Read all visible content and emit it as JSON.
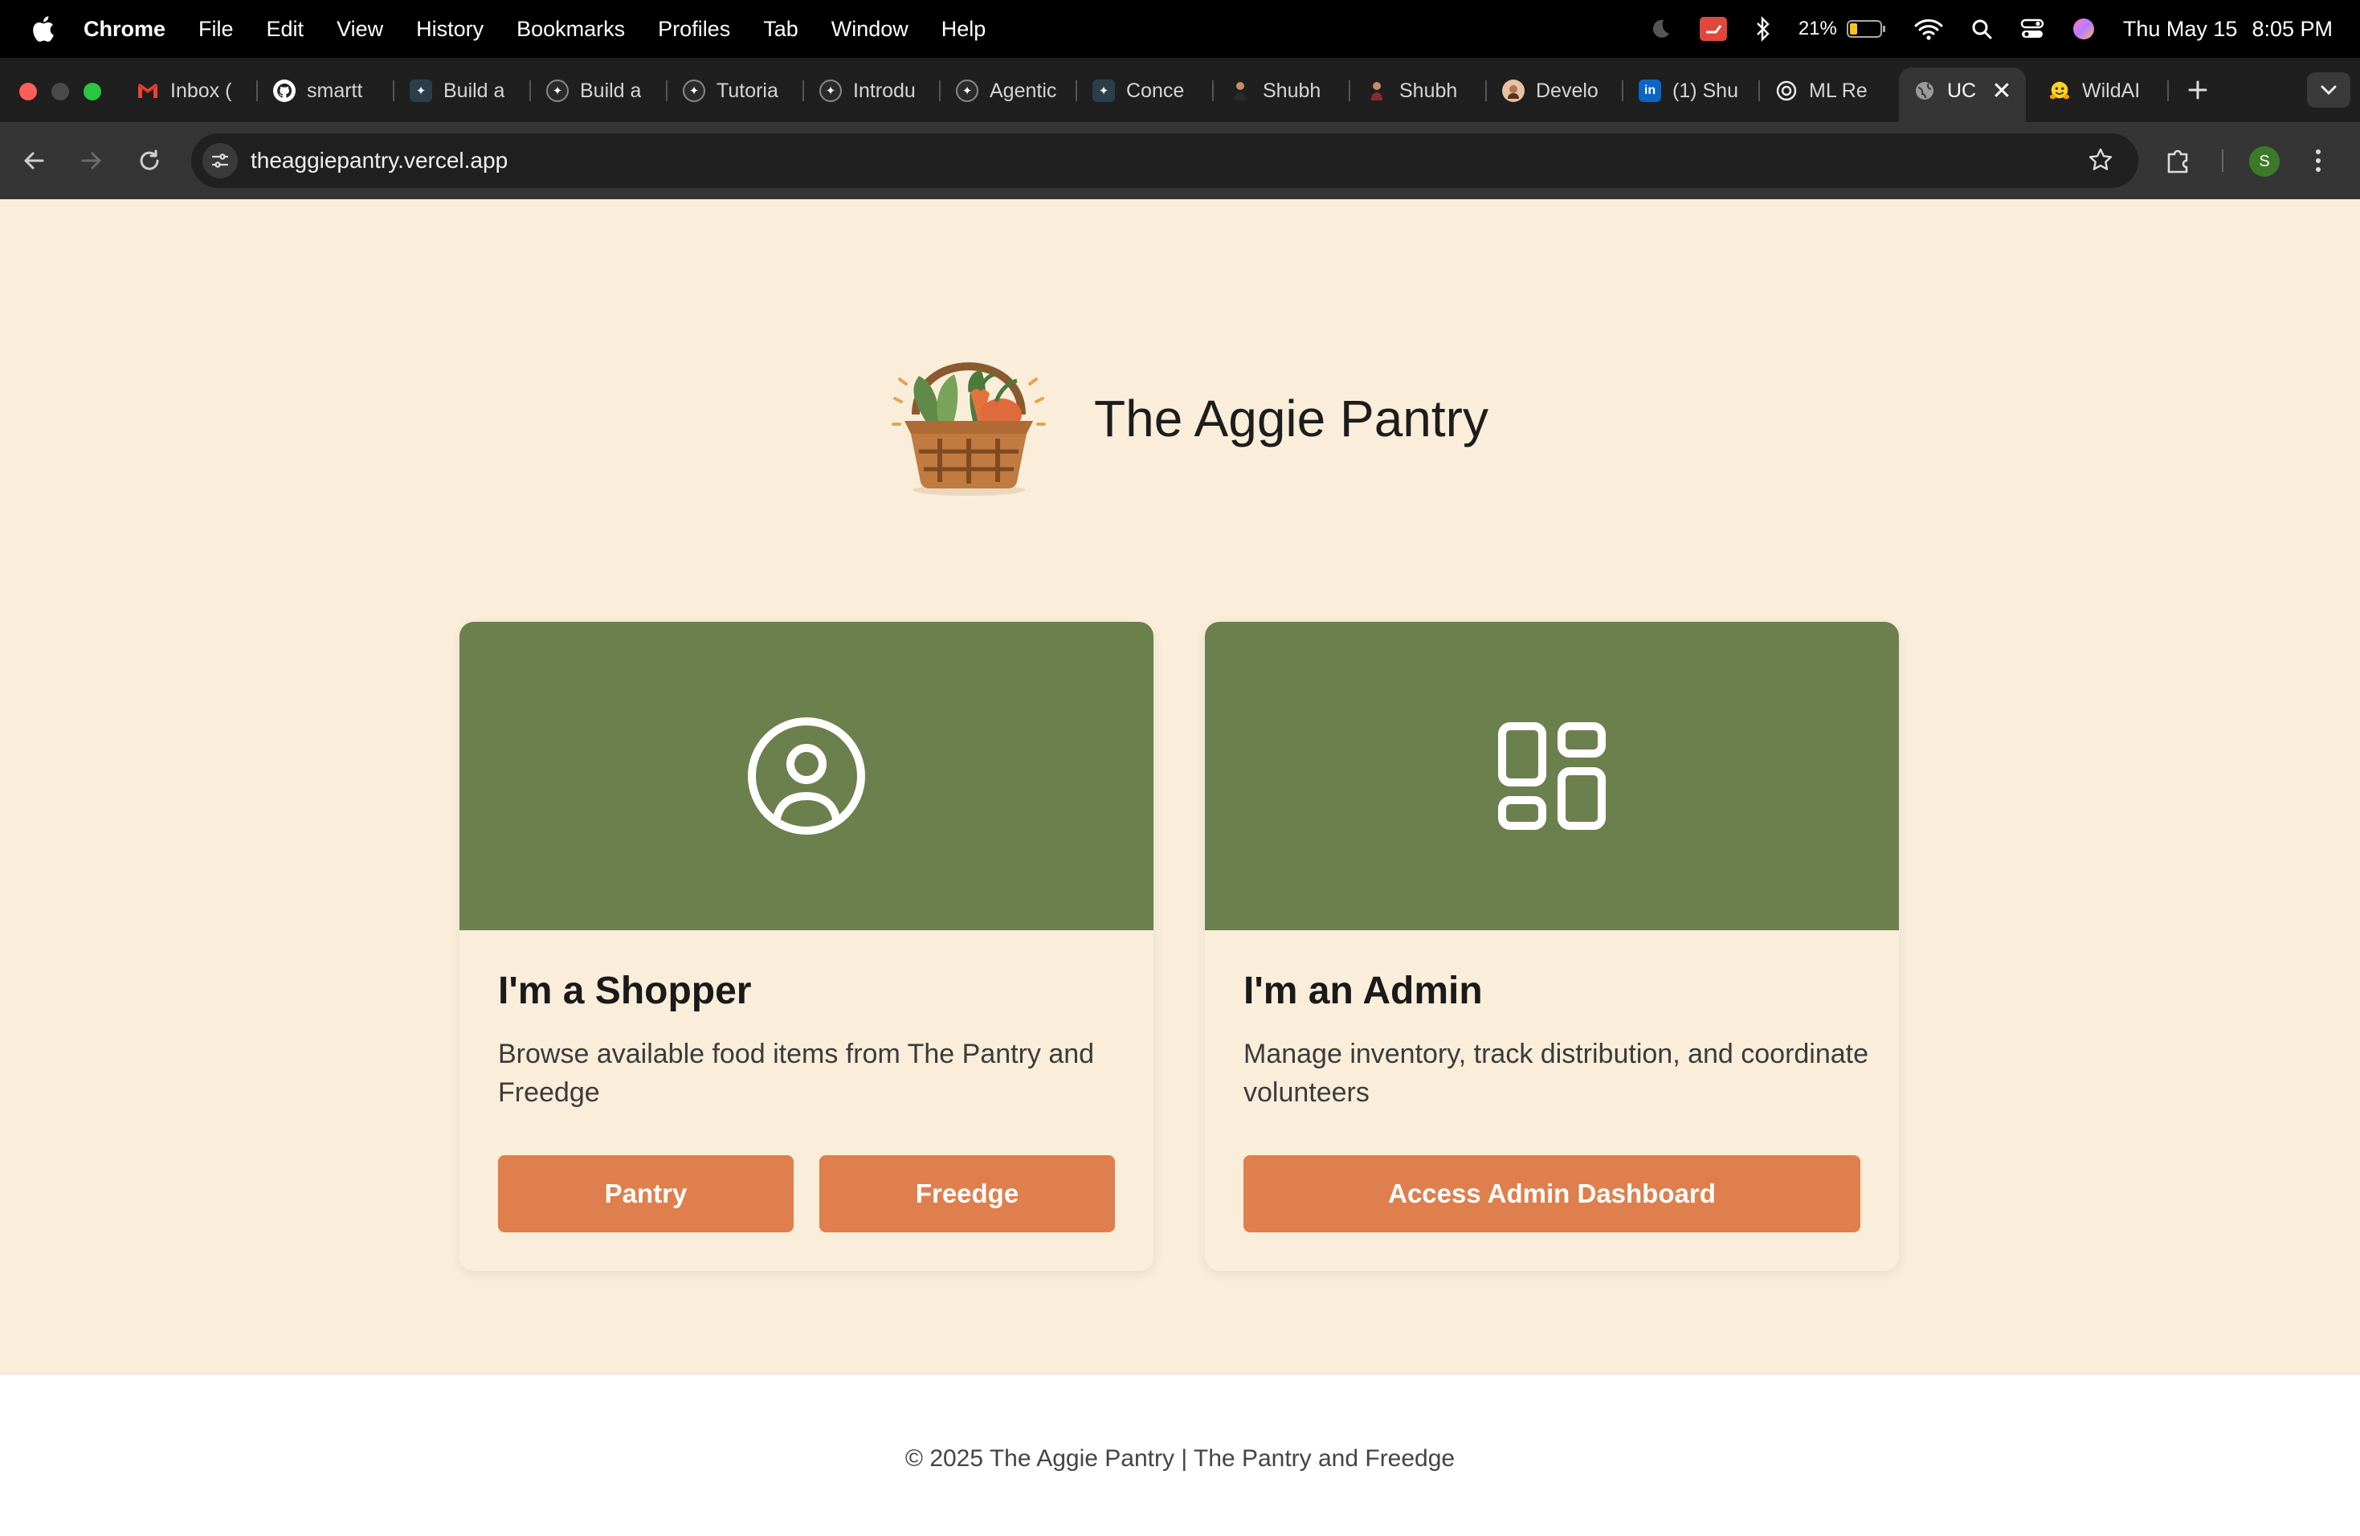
{
  "menubar": {
    "app": "Chrome",
    "items": [
      "File",
      "Edit",
      "View",
      "History",
      "Bookmarks",
      "Profiles",
      "Tab",
      "Window",
      "Help"
    ],
    "battery": "21%",
    "date": "Thu May 15",
    "time": "8:05 PM"
  },
  "tabs": [
    {
      "label": "Inbox (",
      "icon": "gmail-icon"
    },
    {
      "label": "smartt",
      "icon": "github-icon"
    },
    {
      "label": "Build a",
      "icon": "discord-icon"
    },
    {
      "label": "Build a",
      "icon": "discord-icon"
    },
    {
      "label": "Tutoria",
      "icon": "discord-icon"
    },
    {
      "label": "Introdu",
      "icon": "discord-icon"
    },
    {
      "label": "Agentic",
      "icon": "discord-icon"
    },
    {
      "label": "Conce",
      "icon": "discord-icon"
    },
    {
      "label": "Shubh",
      "icon": "person-icon"
    },
    {
      "label": "Shubh",
      "icon": "person-icon"
    },
    {
      "label": "Develo",
      "icon": "avatar-icon"
    },
    {
      "label": "(1) Shu",
      "icon": "linkedin-icon"
    },
    {
      "label": "ML Re",
      "icon": "openai-icon"
    },
    {
      "label": "UC",
      "icon": "globe-icon",
      "active": true
    },
    {
      "label": "WildAI",
      "icon": "huggingface-icon"
    }
  ],
  "toolbar": {
    "url": "theaggiepantry.vercel.app",
    "profile_initial": "S"
  },
  "hero": {
    "title": "The Aggie Pantry"
  },
  "shopper_card": {
    "heading": "I'm a Shopper",
    "description": "Browse available food items from The Pantry and Freedge",
    "buttons": [
      "Pantry",
      "Freedge"
    ]
  },
  "admin_card": {
    "heading": "I'm an Admin",
    "description": "Manage inventory, track distribution, and coordinate volunteers",
    "button": "Access Admin Dashboard"
  },
  "footer": {
    "text": "© 2025 The Aggie Pantry | The Pantry and Freedge"
  },
  "colors": {
    "page_bg": "#faeedb",
    "banner_green": "#6c804e",
    "button_orange": "#df7f4d"
  }
}
